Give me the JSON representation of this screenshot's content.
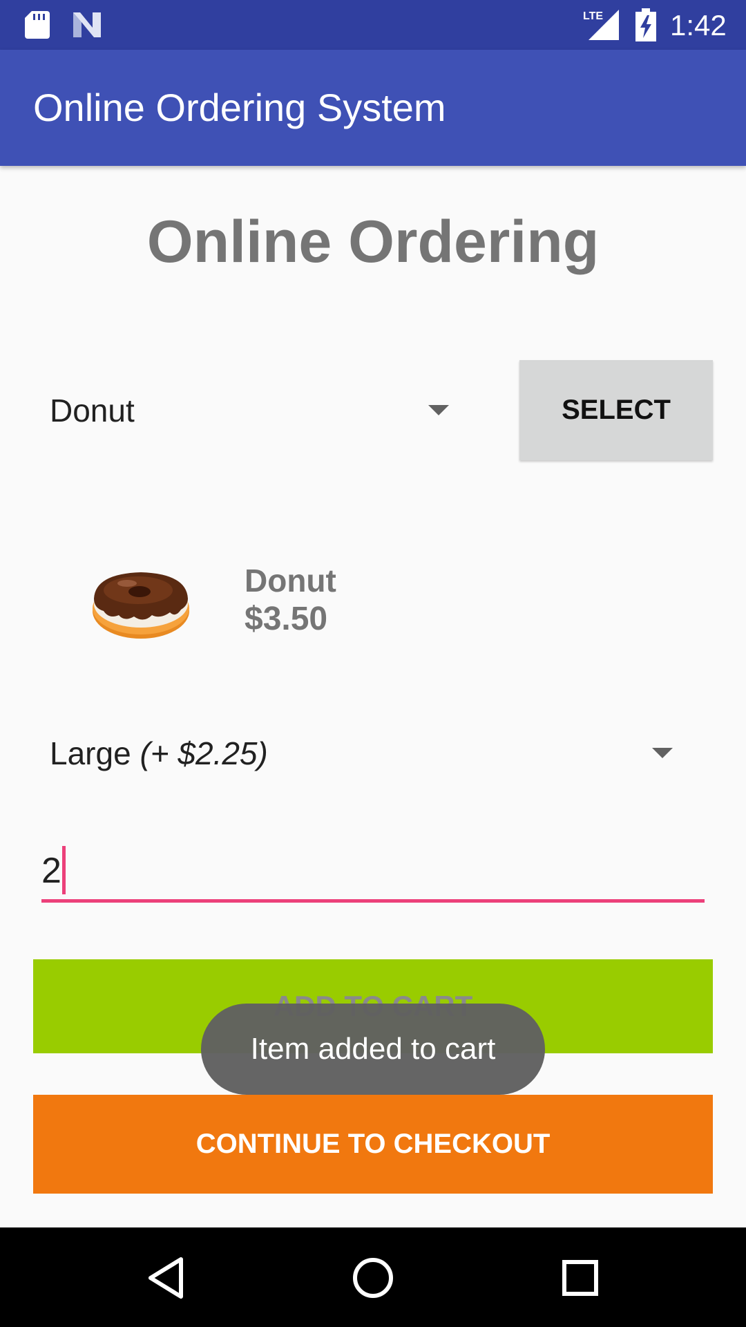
{
  "status_bar": {
    "time": "1:42",
    "network_label": "LTE",
    "icons": [
      "sd-card-icon",
      "n-notification-icon",
      "lte-signal-icon",
      "battery-charging-icon"
    ]
  },
  "app_bar": {
    "title": "Online Ordering System"
  },
  "heading": "Online Ordering",
  "item_select": {
    "selected": "Donut"
  },
  "select_button": {
    "label": "SELECT"
  },
  "product": {
    "name": "Donut",
    "price": "$3.50",
    "image": "donut-image"
  },
  "size_select": {
    "selected_size": "Large",
    "selected_extra": "(+ $2.25)"
  },
  "quantity": {
    "value": "2"
  },
  "add_to_cart": {
    "label": "ADD TO CART"
  },
  "checkout": {
    "label": "CONTINUE TO CHECKOUT"
  },
  "toast": {
    "message": "Item added to cart"
  },
  "nav": {
    "icons": [
      "back-icon",
      "home-icon",
      "recents-icon"
    ]
  },
  "colors": {
    "status_bar": "#303f9f",
    "app_bar": "#3f51b5",
    "add_to_cart": "#99cc00",
    "checkout": "#f1780f",
    "accent": "#ec407a"
  }
}
